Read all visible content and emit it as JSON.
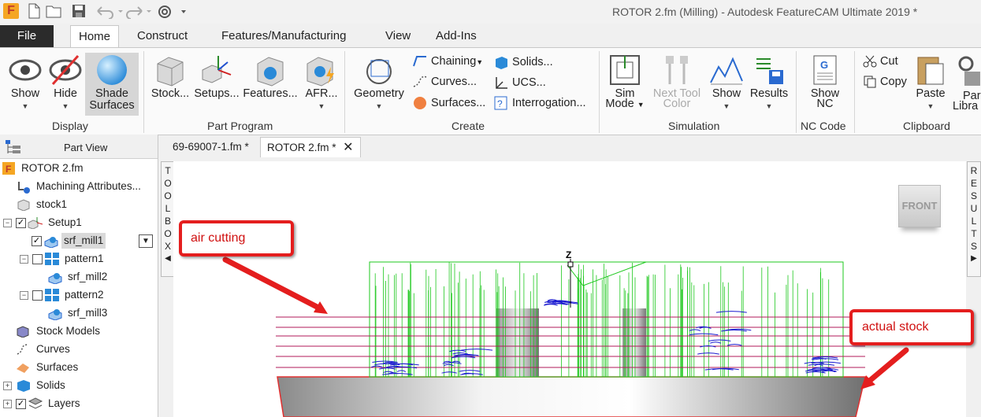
{
  "window": {
    "title": "ROTOR 2.fm (Milling) - Autodesk FeatureCAM Ultimate 2019 *",
    "app_icon_letter": "F"
  },
  "ribbon_tabs": [
    "File",
    "Home",
    "Construct",
    "Features/Manufacturing",
    "View",
    "Add-Ins"
  ],
  "ribbon": {
    "display": {
      "label": "Display",
      "show": "Show",
      "hide": "Hide",
      "shade": "Shade",
      "shade2": "Surfaces"
    },
    "part_program": {
      "label": "Part Program",
      "stock": "Stock...",
      "setups": "Setups...",
      "features": "Features...",
      "afr": "AFR..."
    },
    "create": {
      "label": "Create",
      "geometry": "Geometry",
      "chaining": "Chaining",
      "curves": "Curves...",
      "surfaces": "Surfaces...",
      "solids": "Solids...",
      "ucs": "UCS...",
      "interrogation": "Interrogation..."
    },
    "simulation": {
      "label": "Simulation",
      "sim": "Sim",
      "mode": "Mode",
      "next_tool": "Next Tool",
      "color": "Color",
      "show": "Show",
      "results": "Results"
    },
    "nc_code": {
      "label": "NC Code",
      "show": "Show",
      "nc": "NC"
    },
    "clipboard": {
      "label": "Clipboard",
      "cut": "Cut",
      "copy": "Copy",
      "paste": "Paste",
      "part1": "Par",
      "part2": "Libra"
    }
  },
  "part_view": {
    "title": "Part View",
    "items": [
      "ROTOR 2.fm",
      "Machining Attributes...",
      "stock1",
      "Setup1",
      "srf_mill1",
      "pattern1",
      "srf_mill2",
      "pattern2",
      "srf_mill3",
      "Stock Models",
      "Curves",
      "Surfaces",
      "Solids",
      "Layers"
    ]
  },
  "doc_tabs": [
    "69-69007-1.fm *",
    "ROTOR 2.fm *"
  ],
  "toolbox_label": [
    "T",
    "O",
    "O",
    "L",
    "B",
    "O",
    "X"
  ],
  "results_label": [
    "R",
    "E",
    "S",
    "U",
    "L",
    "T",
    "S"
  ],
  "view_cube": "FRONT",
  "axis_label": "Z",
  "annotations": {
    "air_cutting": "air cutting",
    "actual_stock": "actual stock"
  },
  "colors": {
    "toolpath_green": "#1ec81e",
    "toolpath_blue": "#1a1ad0",
    "stock_lines": "#b0185a",
    "callout_red": "#e41e1e"
  }
}
